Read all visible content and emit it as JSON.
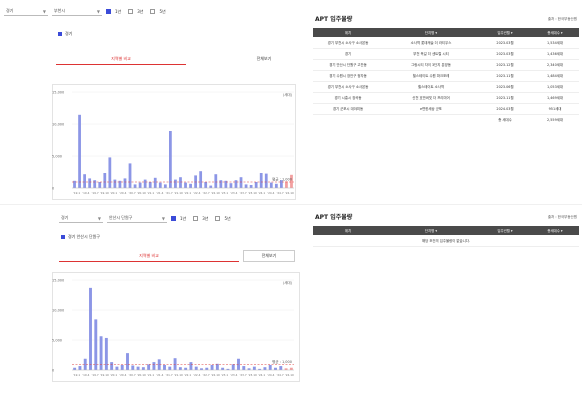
{
  "colors": {
    "bar": "#8c96e6",
    "bar_recent": "#f3a0a0",
    "ref_line": "#e04040",
    "accent": "#3b4bd8",
    "header": "#4a4a4a"
  },
  "top": {
    "filters": {
      "select1": "경기",
      "select2": "부천시",
      "checks": [
        {
          "label": "1년",
          "on": true
        },
        {
          "label": "3년",
          "on": false
        },
        {
          "label": "5년",
          "on": false
        }
      ]
    },
    "legend": "경기",
    "buttons": {
      "primary": "지역별 비교",
      "secondary": "전체보기"
    },
    "chart": {
      "ylabels": [
        "15,000",
        "10,000",
        "5,000",
        "0"
      ],
      "unit": "(세대)",
      "ref_label": "평균 : 1,000",
      "xlabels": [
        "'19.1",
        "'19.4",
        "'19.7",
        "'19.10",
        "'20.1",
        "'20.4",
        "'20.7",
        "'20.10",
        "'21.1",
        "'21.4",
        "'21.7",
        "'21.10",
        "'22.1",
        "'22.4",
        "'22.7",
        "'22.10",
        "'23.1",
        "'23.4",
        "'23.7",
        "'23.10",
        "'24.1",
        "'24.4",
        "'24.7",
        "'24.10"
      ]
    }
  },
  "table_top": {
    "title": "APT 입주물량",
    "unit": "출처 : 한국부동산원",
    "headers": [
      "위치",
      "단지명 ▾",
      "입주년월 ▾",
      "총세대수 ▾"
    ],
    "rows": [
      [
        "경기 부천시 소사구 소사본동",
        "소사역 롯데캐슬 더 라티우스",
        "2023.03월",
        "1,534세대"
      ],
      [
        "경기",
        "부천 옥길 더 센트럴 시티",
        "2023.03월",
        "1,436세대"
      ],
      [
        "경기 안산시 단원구 고잔동",
        "그랑시티 자이 3단지 분양동",
        "2023.12월",
        "2,340세대"
      ],
      [
        "경기 수원시 장안구 정자동",
        "힐스테이트 수원 파크포레",
        "2023.11월",
        "1,484세대"
      ],
      [
        "경기 부천시 소사구 소사본동",
        "힐스테이트 소사역",
        "2023.06월",
        "1,053세대"
      ],
      [
        "경기 시흥시 장곡동",
        "신천 호반써밋 더 프리미어",
        "2023.11월",
        "1,469세대"
      ],
      [
        "경기 군포시 대야미동",
        "e편한세상 군포",
        "2024.03월",
        "951세대"
      ]
    ],
    "summary": {
      "label": "총 세대수",
      "value": "2,559세대"
    }
  },
  "bottom": {
    "filters": {
      "select1": "경기",
      "select2": "안산시 단원구",
      "checks": [
        {
          "label": "1년",
          "on": true
        },
        {
          "label": "3년",
          "on": false
        },
        {
          "label": "5년",
          "on": false
        }
      ]
    },
    "legend": "경기 안산시 단원구",
    "buttons": {
      "primary": "지역별 비교",
      "secondary": "전체보기"
    },
    "chart": {
      "ylabels": [
        "15,000",
        "10,000",
        "5,000",
        "0"
      ],
      "unit": "(세대)",
      "ref_label": "평균 : 1,000",
      "xlabels": [
        "'19.1",
        "'19.4",
        "'19.7",
        "'19.10",
        "'20.1",
        "'20.4",
        "'20.7",
        "'20.10",
        "'21.1",
        "'21.4",
        "'21.7",
        "'21.10",
        "'22.1",
        "'22.4",
        "'22.7",
        "'22.10",
        "'23.1",
        "'23.4",
        "'23.7",
        "'23.10",
        "'24.1",
        "'24.4",
        "'24.7",
        "'24.10"
      ]
    }
  },
  "table_bottom": {
    "title": "APT 입주물량",
    "unit": "출처 : 한국부동산원",
    "headers": [
      "위치",
      "단지명 ▾",
      "입주년월 ▾",
      "총세대수 ▾"
    ],
    "empty": "해당 조건의 입주물량이 없습니다."
  },
  "chart_data": [
    {
      "type": "bar",
      "series": [
        {
          "name": "경기",
          "values": [
            1200,
            12200,
            2300,
            1600,
            1300,
            1000,
            2500,
            5100,
            1400,
            1200,
            1600,
            4100,
            600,
            900,
            1400,
            1000,
            1700,
            900,
            600,
            9500,
            1400,
            1800,
            900,
            700,
            2100,
            2800,
            1000,
            400,
            2300,
            1300,
            1200,
            800,
            1300,
            1800,
            600,
            500,
            1000,
            2500,
            2400,
            900,
            700,
            1300,
            1100,
            2200
          ]
        }
      ],
      "reference_line": 1000,
      "ylim": [
        0,
        16000
      ]
    },
    {
      "type": "bar",
      "series": [
        {
          "name": "경기 안산시 단원구",
          "values": [
            400,
            700,
            2000,
            14600,
            9000,
            6000,
            5700,
            1400,
            600,
            900,
            3000,
            800,
            600,
            500,
            1000,
            1400,
            1900,
            900,
            600,
            2100,
            500,
            400,
            1400,
            600,
            300,
            400,
            900,
            1100,
            400,
            200,
            1000,
            2000,
            700,
            300,
            600,
            200,
            500,
            900,
            400,
            700,
            300,
            400
          ]
        }
      ],
      "reference_line": 1000,
      "ylim": [
        0,
        16000
      ]
    }
  ]
}
